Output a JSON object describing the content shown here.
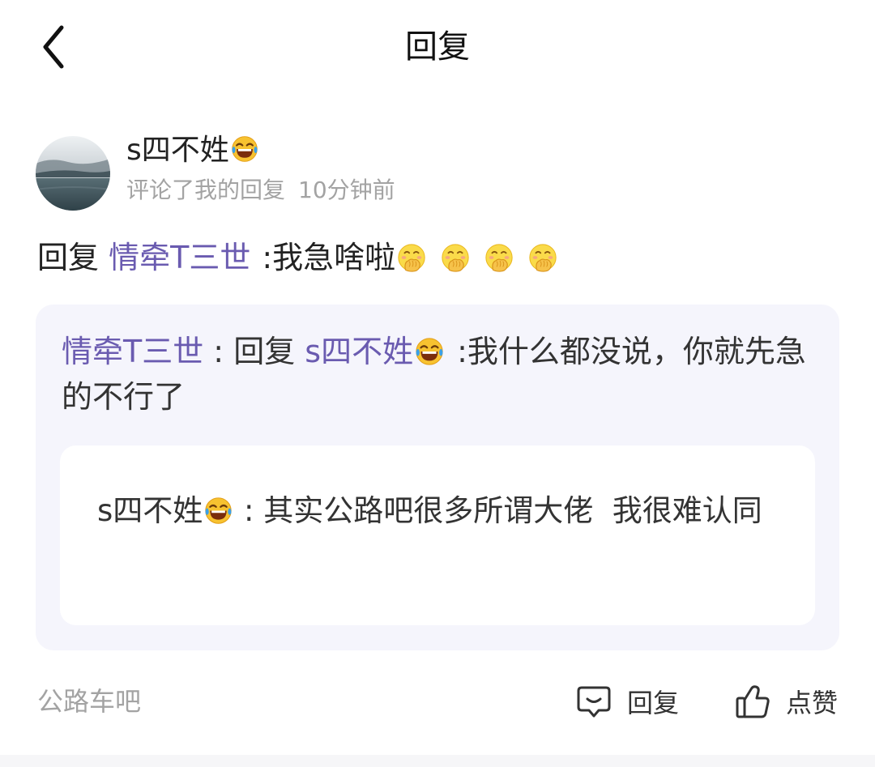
{
  "header": {
    "title": "回复",
    "back_icon": "chevron-left-icon"
  },
  "comment": {
    "author": "s四不姓",
    "author_emoji": "laughing-tears-emoji",
    "action": "评论了我的回复",
    "time": "10分钟前",
    "reply_prefix": "回复",
    "reply_to": "情牵T三世",
    "reply_text": ":我急啥啦",
    "trailing_emoji": "shy-face-emoji",
    "trailing_emoji_count": 4
  },
  "quote": {
    "author": "情牵T三世",
    "separator": " : ",
    "reply_prefix": "回复",
    "reply_to": "s四不姓",
    "text": ":我什么都没说，你就先急的不行了"
  },
  "nested_quote": {
    "author": "s四不姓",
    "separator": " : ",
    "text": "其实公路吧很多所谓大佬  我很难认同"
  },
  "footer": {
    "source": "公路车吧",
    "reply_label": "回复",
    "reply_icon": "comment-bubble-icon",
    "like_label": "点赞",
    "like_icon": "thumbs-up-icon"
  },
  "colors": {
    "link": "#6a5bb0",
    "muted": "#a3a3a3",
    "quote_bg": "#f5f5fc"
  }
}
